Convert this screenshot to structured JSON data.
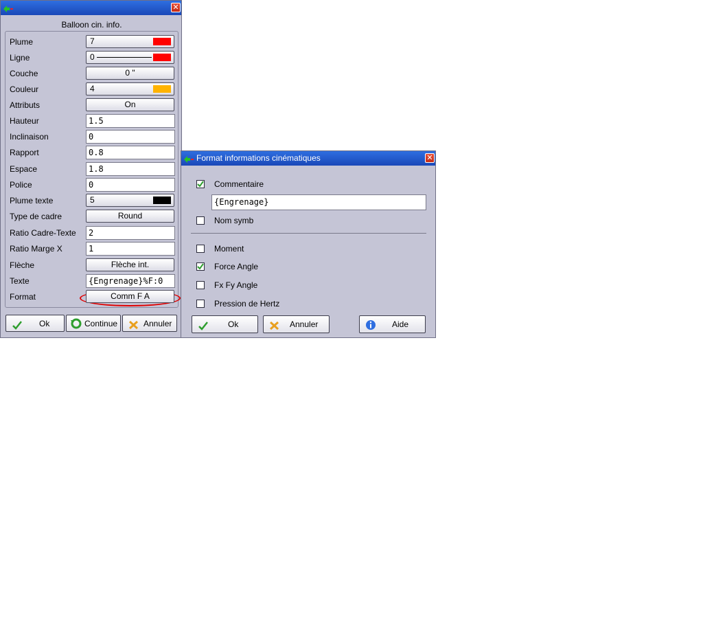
{
  "dialog1": {
    "title": "",
    "heading": "Balloon cin. info.",
    "rows": [
      {
        "label": "Plume",
        "type": "btn-swatch",
        "value": "7",
        "swatch": "#ff0000"
      },
      {
        "label": "Ligne",
        "type": "btn-line",
        "value": "0",
        "swatch": "#ff0000"
      },
      {
        "label": "Couche",
        "type": "btn",
        "value": "0 \""
      },
      {
        "label": "Couleur",
        "type": "btn-swatch",
        "value": "4",
        "swatch": "#ffb300"
      },
      {
        "label": "Attributs",
        "type": "btn",
        "value": "On"
      },
      {
        "label": "Hauteur",
        "type": "field",
        "value": "1.5"
      },
      {
        "label": "Inclinaison",
        "type": "field",
        "value": "0"
      },
      {
        "label": "Rapport",
        "type": "field",
        "value": "0.8"
      },
      {
        "label": "Espace",
        "type": "field",
        "value": "1.8"
      },
      {
        "label": "Police",
        "type": "field",
        "value": "0"
      },
      {
        "label": "Plume texte",
        "type": "btn-swatch",
        "value": "5",
        "swatch": "#000000"
      },
      {
        "label": "Type de cadre",
        "type": "btn",
        "value": "Round"
      },
      {
        "label": "Ratio Cadre-Texte",
        "type": "field",
        "value": "2"
      },
      {
        "label": "Ratio Marge X",
        "type": "field",
        "value": "1"
      },
      {
        "label": "Flèche",
        "type": "btn",
        "value": "Flèche int."
      },
      {
        "label": "Texte",
        "type": "field",
        "value": "{Engrenage}%F:0"
      },
      {
        "label": "Format",
        "type": "btn",
        "value": "Comm F A"
      }
    ],
    "buttons": {
      "ok": "Ok",
      "continue": "Continue",
      "cancel": "Annuler"
    }
  },
  "dialog2": {
    "title": "Format informations cinématiques",
    "comment_label": "Commentaire",
    "comment_checked": true,
    "comment_value": "{Engrenage}",
    "nom_symb_label": "Nom symb",
    "nom_symb_checked": false,
    "moment_label": "Moment",
    "moment_checked": false,
    "force_angle_label": "Force Angle",
    "force_angle_checked": true,
    "fxfy_label": "Fx Fy Angle",
    "fxfy_checked": false,
    "hertz_label": "Pression de Hertz",
    "hertz_checked": false,
    "buttons": {
      "ok": "Ok",
      "cancel": "Annuler",
      "help": "Aide"
    }
  },
  "colors": {
    "ok_check": "#2e9e2e",
    "cancel_x": "#e8a020",
    "info": "#2f6ee0",
    "highlight": "#e00000"
  }
}
